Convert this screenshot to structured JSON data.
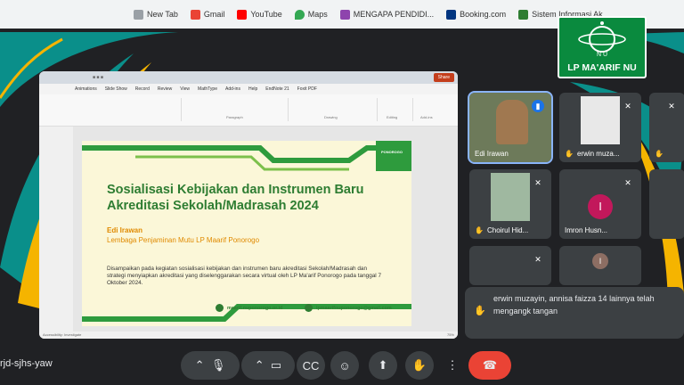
{
  "bookmarks": [
    {
      "label": "New Tab",
      "color": "#9aa0a6"
    },
    {
      "label": "Gmail",
      "color": "#ea4335"
    },
    {
      "label": "YouTube",
      "color": "#ff0000"
    },
    {
      "label": "Maps",
      "color": "#34a853"
    },
    {
      "label": "MENGAPA PENDIDI...",
      "color": "#8e44ad"
    },
    {
      "label": "Booking.com",
      "color": "#003580"
    },
    {
      "label": "Sistem Informasi Ak...",
      "color": "#2e7d32"
    }
  ],
  "ppt": {
    "share_label": "Share",
    "tabs": [
      "Animations",
      "Slide Show",
      "Record",
      "Review",
      "View",
      "MathType",
      "Add-ins",
      "Help",
      "EndNote 21",
      "Foxit PDF"
    ],
    "groups": [
      "Paragraph",
      "Drawing",
      "Editing",
      "Add-ins"
    ],
    "status_left": "Accessibility: Investigate",
    "status_zoom": "75%"
  },
  "slide": {
    "title": "Sosialisasi Kebijakan dan Instrumen Baru Akreditasi Sekolah/Madrasah 2024",
    "presenter": "Edi Irawan",
    "org": "Lembaga Penjaminan Mutu LP Maarif Ponorogo",
    "description": "Disampaikan pada kegiatan sosialisasi kebijakan dan instrumen baru akreditasi Sekolah/Madrasah dan strategi menyiapkan akreditasi yang diselenggarakan secara virtual oleh LP Ma'arif Ponorogo pada tanggal 7 Oktober 2024.",
    "website": "maarif.nuponorogo.or.id",
    "email": "lpmaarifnuponorogo@gmail.com",
    "brand": "PONOROGO"
  },
  "participants": [
    {
      "name": "Edi Irawan",
      "active": true
    },
    {
      "name": "erwin muza...",
      "hand": true
    },
    {
      "name": "",
      "hand": true
    },
    {
      "name": "Choirul Hid...",
      "hand": true
    },
    {
      "name": "Imron Husn...",
      "avatar_letter": "I",
      "avatar_color": "#c2185b"
    },
    {
      "name": ""
    },
    {
      "name": ""
    },
    {
      "name": "",
      "avatar_letter": "I",
      "avatar_color": "#8d6e63"
    }
  ],
  "notification": {
    "text": "erwin muzayin, annisa faizza 14 lainnya telah mengangk tangan"
  },
  "meeting_code": "rjd-sjhs-yaw",
  "logo": {
    "text": "LP MA'ARIF NU",
    "letters": "N U"
  },
  "colors": {
    "green": "#0a8a3e",
    "teal": "#0a8f8a",
    "gold": "#f5b400",
    "end_call": "#ea4335"
  }
}
